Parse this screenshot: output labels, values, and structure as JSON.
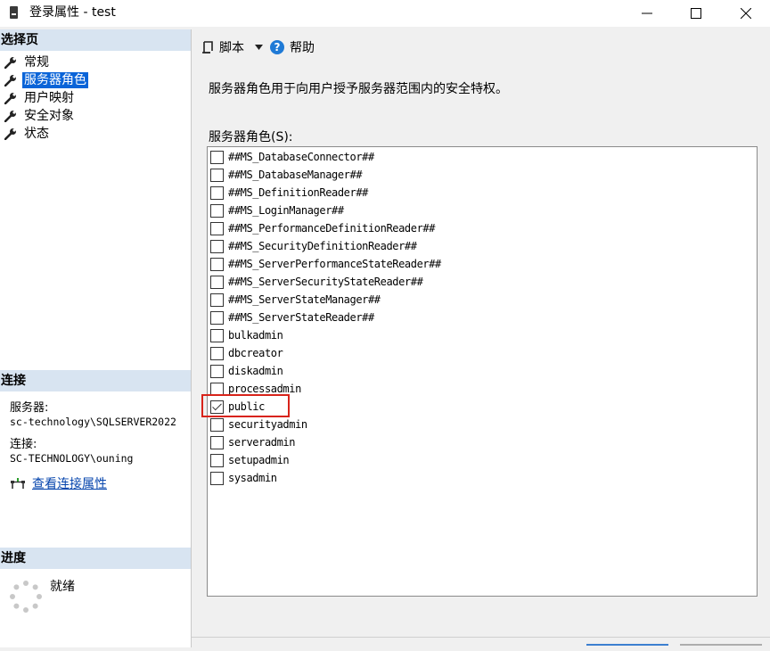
{
  "window": {
    "title": "登录属性 - test",
    "controls": [
      "minimize",
      "maximize",
      "close"
    ]
  },
  "left_pane": {
    "select_page": {
      "header": "选择页",
      "items": [
        {
          "label": "常规",
          "icon": "wrench-icon",
          "selected": false
        },
        {
          "label": "服务器角色",
          "icon": "wrench-icon",
          "selected": true
        },
        {
          "label": "用户映射",
          "icon": "wrench-icon",
          "selected": false
        },
        {
          "label": "安全对象",
          "icon": "wrench-icon",
          "selected": false
        },
        {
          "label": "状态",
          "icon": "wrench-icon",
          "selected": false
        }
      ]
    },
    "connection": {
      "header": "连接",
      "server_label": "服务器:",
      "server_value": "sc-technology\\SQLSERVER2022",
      "connection_label": "连接:",
      "connection_value": "SC-TECHNOLOGY\\ouning",
      "view_properties_link": "查看连接属性"
    },
    "progress": {
      "header": "进度",
      "status": "就绪"
    }
  },
  "toolbar": {
    "script_label": "脚本",
    "help_label": "帮助"
  },
  "main": {
    "description": "服务器角色用于向用户授予服务器范围内的安全特权。",
    "roles_label": "服务器角色(S):",
    "roles": [
      {
        "name": "##MS_DatabaseConnector##",
        "checked": false
      },
      {
        "name": "##MS_DatabaseManager##",
        "checked": false
      },
      {
        "name": "##MS_DefinitionReader##",
        "checked": false
      },
      {
        "name": "##MS_LoginManager##",
        "checked": false
      },
      {
        "name": "##MS_PerformanceDefinitionReader##",
        "checked": false
      },
      {
        "name": "##MS_SecurityDefinitionReader##",
        "checked": false
      },
      {
        "name": "##MS_ServerPerformanceStateReader##",
        "checked": false
      },
      {
        "name": "##MS_ServerSecurityStateReader##",
        "checked": false
      },
      {
        "name": "##MS_ServerStateManager##",
        "checked": false
      },
      {
        "name": "##MS_ServerStateReader##",
        "checked": false
      },
      {
        "name": "bulkadmin",
        "checked": false
      },
      {
        "name": "dbcreator",
        "checked": false
      },
      {
        "name": "diskadmin",
        "checked": false
      },
      {
        "name": "processadmin",
        "checked": false
      },
      {
        "name": "public",
        "checked": true
      },
      {
        "name": "securityadmin",
        "checked": false
      },
      {
        "name": "serveradmin",
        "checked": false
      },
      {
        "name": "setupadmin",
        "checked": false
      },
      {
        "name": "sysadmin",
        "checked": false
      }
    ]
  },
  "colors": {
    "selection": "#0a64d8",
    "section_header": "#d8e4f1",
    "annotation": "#d8231a",
    "link": "#0645ad",
    "help_icon": "#1f7ad6"
  }
}
